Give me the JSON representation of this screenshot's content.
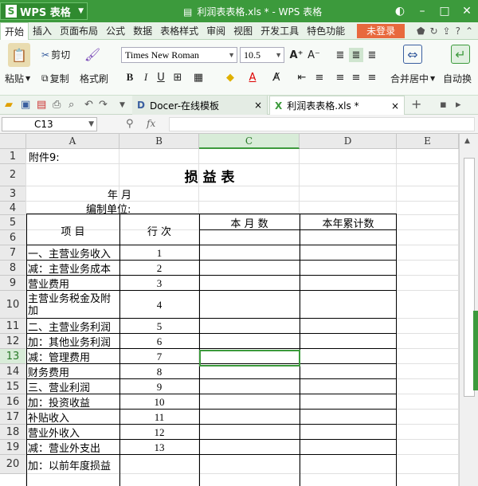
{
  "app": {
    "brand": "WPS 表格",
    "logo_letter": "S",
    "window_title": "利润表表格.xls * - WPS 表格",
    "accent": "#3c9a3c"
  },
  "menu": {
    "items": [
      "开始",
      "插入",
      "页面布局",
      "公式",
      "数据",
      "表格样式",
      "审阅",
      "视图",
      "开发工具",
      "特色功能"
    ],
    "login": "未登录"
  },
  "ribbon": {
    "cut": "剪切",
    "paste": "粘贴",
    "copy": "复制",
    "format_painter": "格式刷",
    "font_name": "Times New Roman",
    "font_size": "10.5",
    "bold": "B",
    "italic": "I",
    "underline": "U",
    "merge_center": "合并居中",
    "auto_wrap": "自动换"
  },
  "tabs": {
    "doc_template": "Docer-在线模板",
    "file": "利润表表格.xls *",
    "close": "×",
    "add": "+"
  },
  "formula": {
    "cell_ref": "C13",
    "fx": "fx",
    "value": ""
  },
  "columns": [
    "A",
    "B",
    "C",
    "D",
    "E"
  ],
  "sheet": {
    "title": "损  益  表",
    "annex": "附件9:",
    "year_month": "年      月",
    "compiler": "编制单位:",
    "hdr_item": "项       目",
    "hdr_line": "行 次",
    "hdr_month": "本 月 数",
    "hdr_year": "本年累计数",
    "rows": [
      {
        "r": "1"
      },
      {
        "r": "2"
      },
      {
        "r": "3"
      },
      {
        "r": "4"
      },
      {
        "r": "5"
      },
      {
        "r": "6"
      },
      {
        "r": "7",
        "item": "一、主营业务收入",
        "line": "1"
      },
      {
        "r": "8",
        "item": "减：主营业务成本",
        "line": "2"
      },
      {
        "r": "9",
        "item": "营业费用",
        "line": "3"
      },
      {
        "r": "10",
        "item": "主营业务税金及附加",
        "line": "4"
      },
      {
        "r": "11",
        "item": "二、主营业务利润",
        "line": "5"
      },
      {
        "r": "12",
        "item": "加：其他业务利润",
        "line": "6"
      },
      {
        "r": "13",
        "item": "减：管理费用",
        "line": "7"
      },
      {
        "r": "14",
        "item": "财务费用",
        "line": "8"
      },
      {
        "r": "15",
        "item": "三、营业利润",
        "line": "9"
      },
      {
        "r": "16",
        "item": "加：投资收益",
        "line": "10"
      },
      {
        "r": "17",
        "item": "补贴收入",
        "line": "11"
      },
      {
        "r": "18",
        "item": "营业外收入",
        "line": "12"
      },
      {
        "r": "19",
        "item": "减：营业外支出",
        "line": "13"
      },
      {
        "r": "20",
        "item": "加：以前年度损益",
        "line": ""
      }
    ]
  }
}
